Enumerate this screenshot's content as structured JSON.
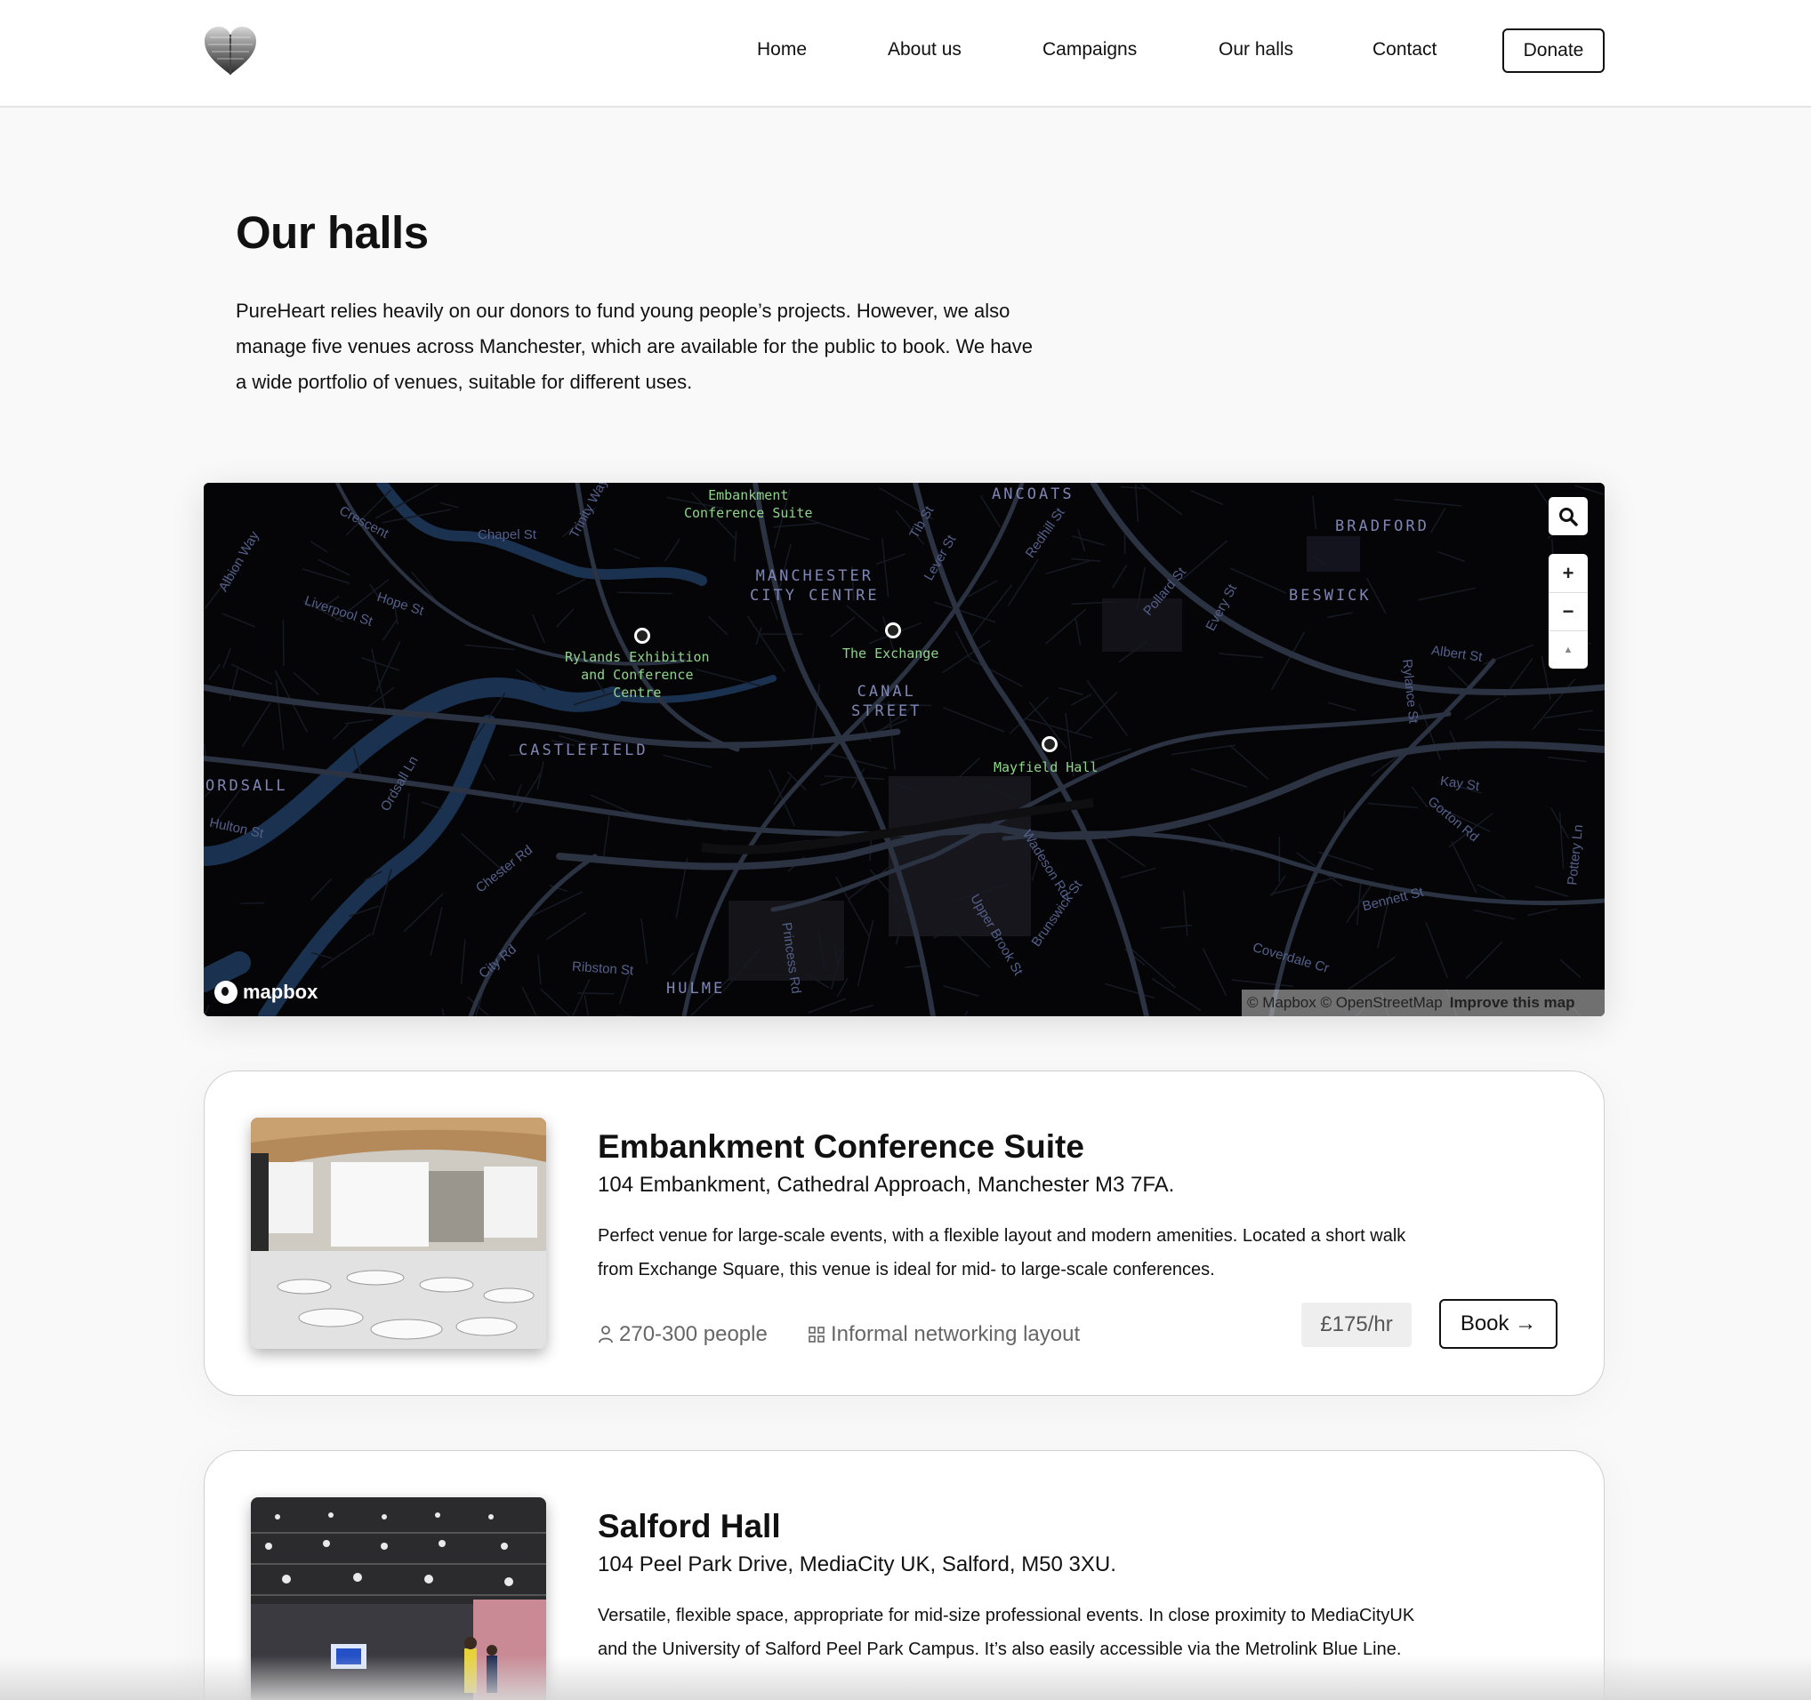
{
  "nav": {
    "items": [
      "Home",
      "About us",
      "Campaigns",
      "Our halls",
      "Contact"
    ],
    "donate_label": "Donate",
    "logo_icon": "heart-logo-icon"
  },
  "intro": {
    "title": "Our halls",
    "paragraph": "PureHeart relies heavily on our donors to fund young people’s projects. However, we also manage five venues across Manchester, which are available for the public to book. We have a wide portfolio of venues, suitable for different uses."
  },
  "map": {
    "venues": [
      "Embankment\nConference Suite",
      "Rylands Exhibition\nand Conference\nCentre",
      "The Exchange",
      "Mayfield Hall"
    ],
    "districts": [
      "ANCOATS",
      "BRADFORD",
      "BESWICK",
      "MANCHESTER\nCITY CENTRE",
      "CANAL\nSTREET",
      "CASTLEFIELD",
      "ORDSALL",
      "HULME"
    ],
    "streets": [
      "Chapel St",
      "Crescent",
      "Trinity Way",
      "Albion Way",
      "Liverpool St",
      "Hope St",
      "Tib St",
      "Lever St",
      "Redhill St",
      "Pollard St",
      "Every St",
      "Albert St",
      "Rylance St",
      "Kay St",
      "Gorton Rd",
      "Pottery Ln",
      "Bennett St",
      "Coverdale Cr",
      "Brunswick St",
      "Upper Brook St",
      "Wadeson Rd",
      "Princess Rd",
      "Ribston St",
      "City Rd",
      "Chester Rd",
      "Ordsall Ln",
      "Hulton St"
    ],
    "controls": {
      "zoom_in": "+",
      "zoom_out": "−",
      "compass": "▲"
    },
    "logo_text": "mapbox",
    "attribution": "© Mapbox © OpenStreetMap",
    "improve": "Improve this map",
    "water_color": "#1a3150",
    "road_color": "#2b3342"
  },
  "halls": [
    {
      "name": "Embankment Conference Suite",
      "address": "104 Embankment, Cathedral Approach, Manchester M3 7FA.",
      "description": "Perfect venue for large-scale events, with a flexible layout and modern amenities. Located a short walk from Exchange Square, this venue is ideal for mid- to large-scale conferences.",
      "capacity": "270-300 people",
      "layout": "Informal networking layout",
      "price": "£175/hr",
      "book_label": "Book →"
    },
    {
      "name": "Salford Hall",
      "address": "104 Peel Park Drive, MediaCity UK, Salford, M50 3XU.",
      "description": "Versatile, flexible space, appropriate for mid-size professional events. In close proximity to MediaCityUK and the University of Salford Peel Park Campus. It’s also easily accessible via the Metrolink Blue Line."
    }
  ]
}
